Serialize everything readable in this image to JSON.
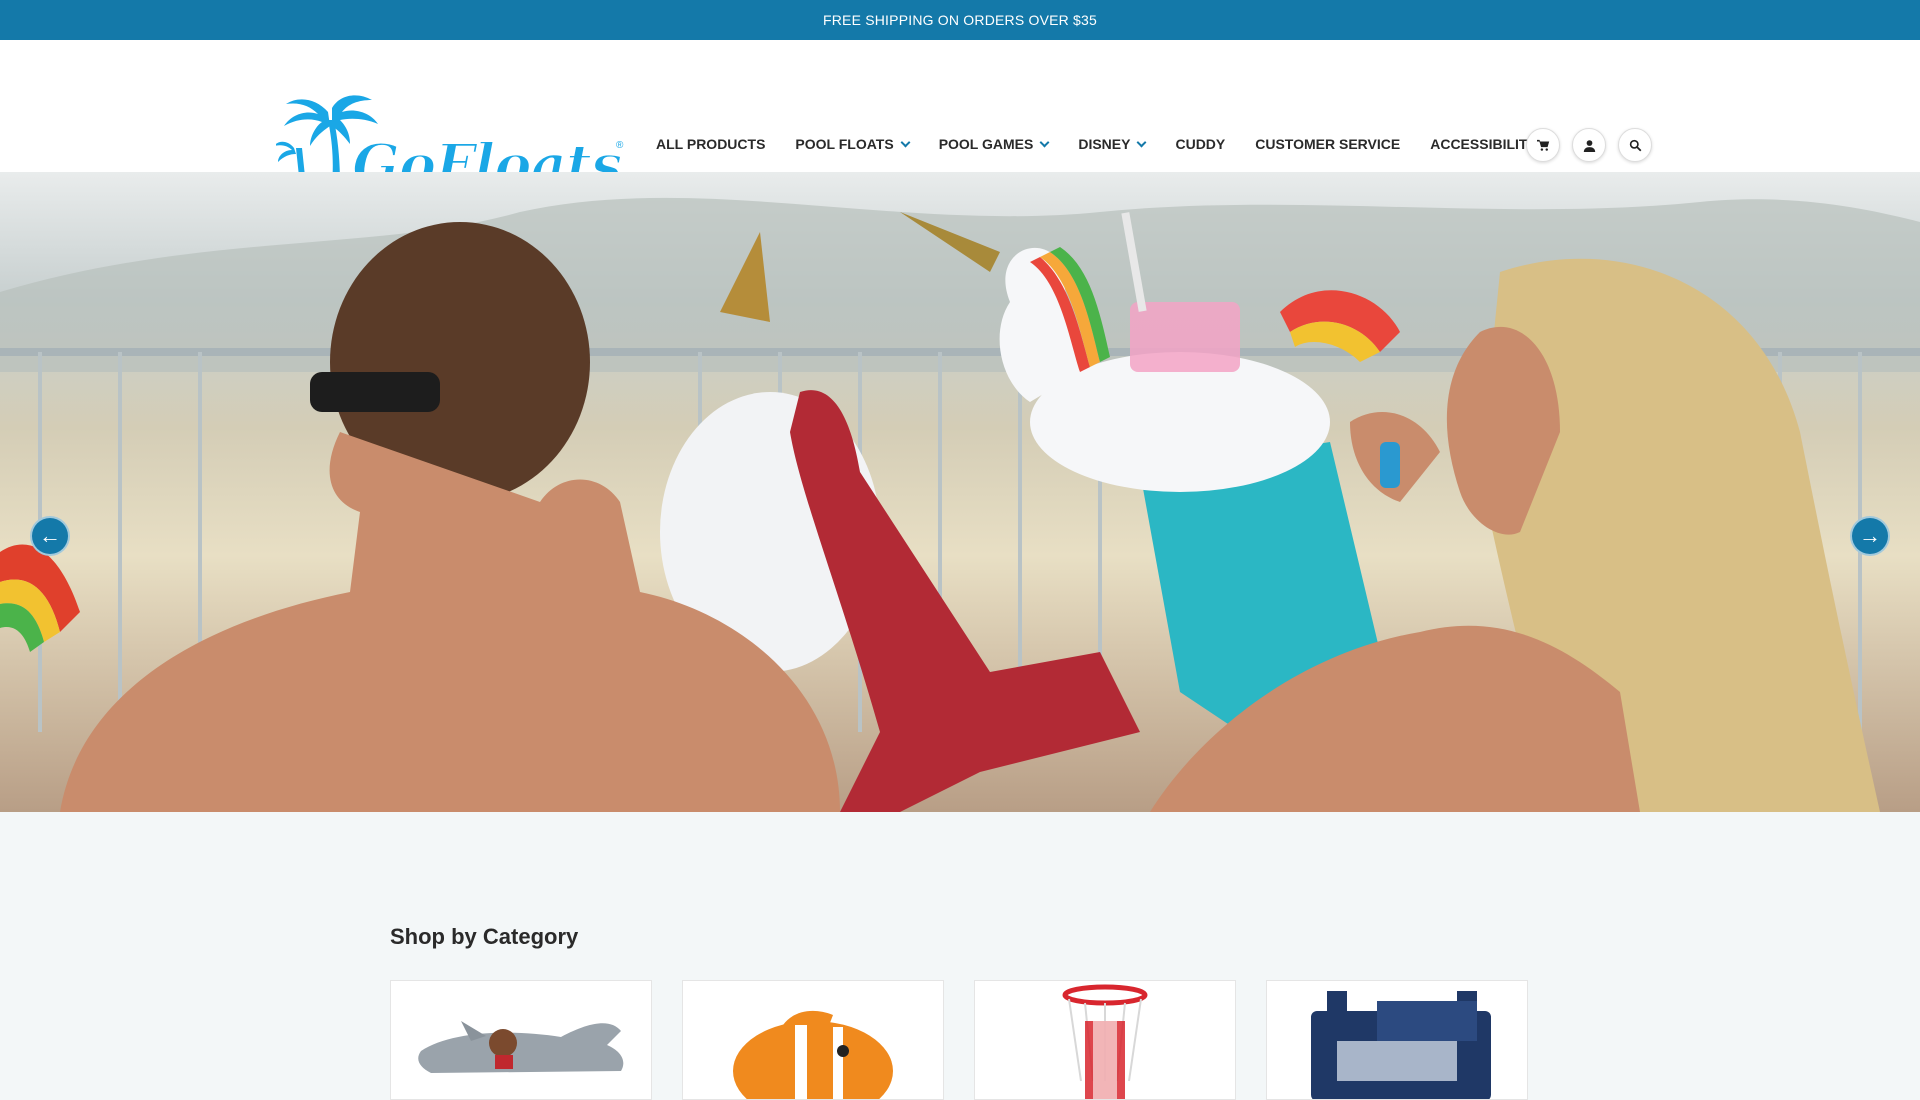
{
  "announcement": "FREE SHIPPING ON ORDERS OVER $35",
  "logo": {
    "text": "GoFloats",
    "reg": "®"
  },
  "nav": [
    {
      "label": "ALL PRODUCTS",
      "dropdown": false
    },
    {
      "label": "POOL FLOATS",
      "dropdown": true
    },
    {
      "label": "POOL GAMES",
      "dropdown": true
    },
    {
      "label": "DISNEY",
      "dropdown": true
    },
    {
      "label": "CUDDY",
      "dropdown": false
    },
    {
      "label": "CUSTOMER SERVICE",
      "dropdown": false
    },
    {
      "label": "ACCESSIBILITY",
      "dropdown": false
    }
  ],
  "header_icons": [
    "cart-icon",
    "user-icon",
    "search-icon"
  ],
  "hero": {
    "prev_arrow": "←",
    "next_arrow": "→"
  },
  "shop_by_category": {
    "title": "Shop by Category",
    "cards": [
      "shark-float",
      "clownfish-float",
      "basketball-hoop",
      "cooler"
    ]
  },
  "colors": {
    "brand_blue": "#1479a9",
    "logo_blue": "#1aa7e6"
  }
}
